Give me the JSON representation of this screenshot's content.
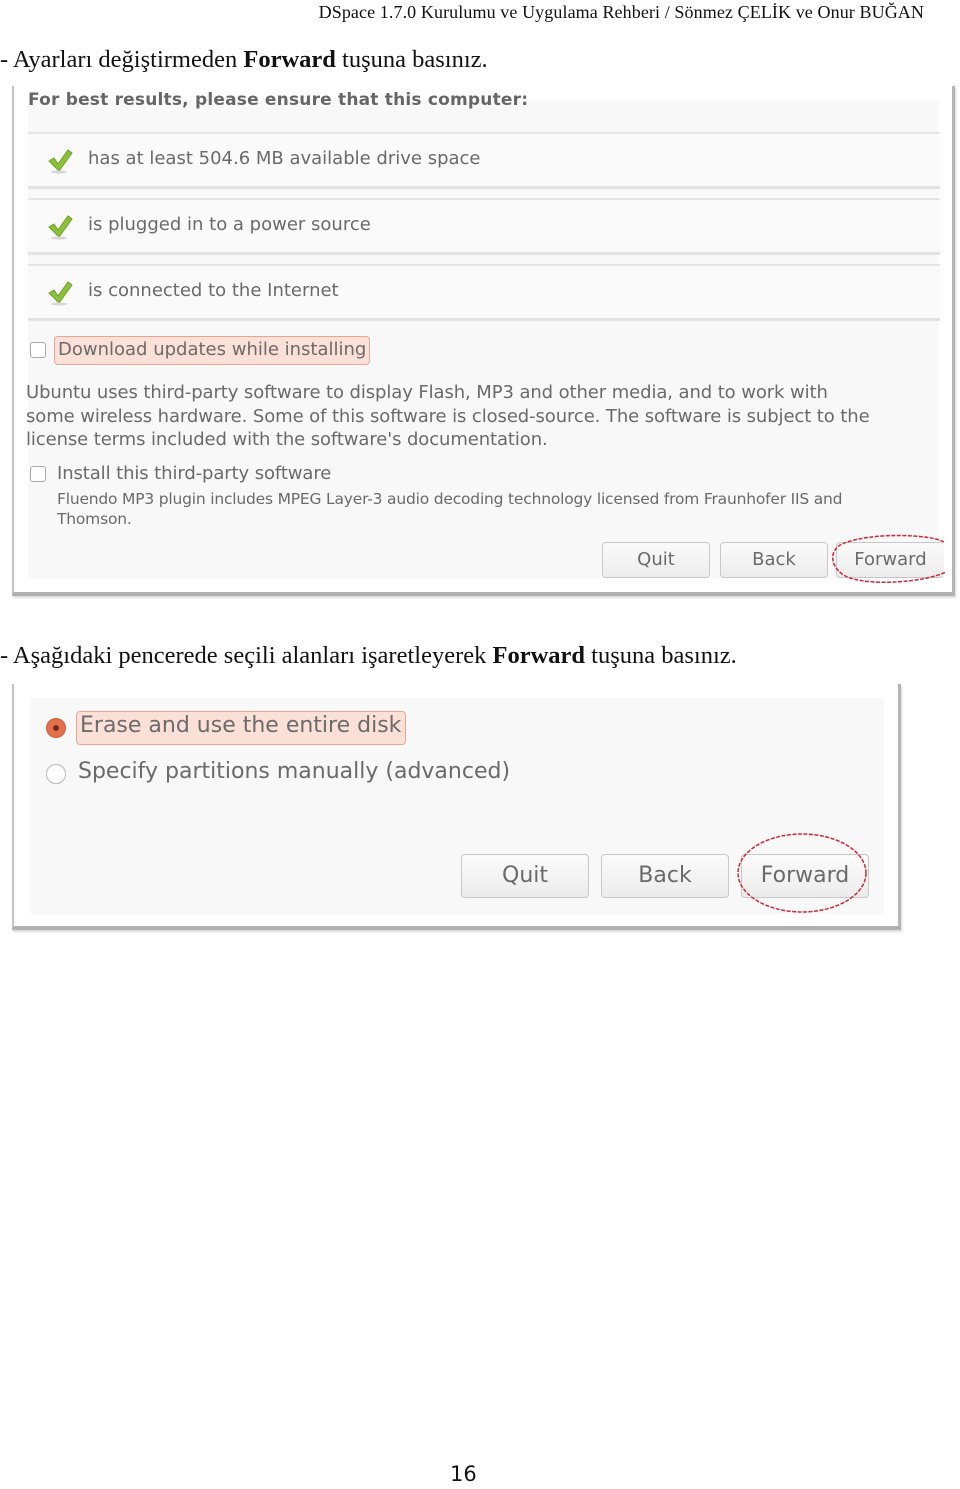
{
  "header": {
    "text": "DSpace 1.7.0  Kurulumu ve Uygulama Rehberi / Sönmez ÇELİK ve Onur BUĞAN"
  },
  "section1": {
    "instruction_prefix": "- Ayarları değiştirmeden ",
    "instruction_bold": "Forward",
    "instruction_suffix": " tuşuna basınız.",
    "screenshot": {
      "title": "For best results, please ensure that this computer:",
      "checks": [
        {
          "icon": "checkmark-icon",
          "label": "has at least 504.6 MB available drive space",
          "status": "ok"
        },
        {
          "icon": "checkmark-icon",
          "label": "is plugged in to a power source",
          "status": "ok"
        },
        {
          "icon": "checkmark-icon",
          "label": "is connected to the Internet",
          "status": "ok"
        }
      ],
      "download_updates": {
        "label": "Download updates while installing",
        "checked": false,
        "highlighted": true
      },
      "third_party_text": [
        "Ubuntu uses third-party software to display Flash, MP3 and other media, and to work with",
        "some wireless hardware. Some of this software is closed-source. The software is subject to the",
        "license terms included with the software's documentation."
      ],
      "install_third_party": {
        "label": "Install this third-party software",
        "checked": false
      },
      "fluendo_text": [
        "Fluendo MP3 plugin includes MPEG Layer-3 audio decoding technology licensed from Fraunhofer IIS and",
        "Thomson."
      ],
      "buttons": {
        "quit": "Quit",
        "back": "Back",
        "forward": "Forward"
      }
    }
  },
  "section2": {
    "instruction_prefix": "- Aşağıdaki pencerede seçili alanları işaretleyerek ",
    "instruction_bold": "Forward",
    "instruction_suffix": " tuşuna basınız.",
    "screenshot": {
      "options": [
        {
          "label": "Erase and use the entire disk",
          "selected": true,
          "highlighted": true
        },
        {
          "label": "Specify partitions manually (advanced)",
          "selected": false
        }
      ],
      "buttons": {
        "quit": "Quit",
        "back": "Back",
        "forward": "Forward"
      }
    }
  },
  "colors": {
    "highlight_fill": "#fbe0d8",
    "highlight_border": "#e8a58f",
    "annotation_circle": "#d0283a",
    "radio_selected": "#e4714e",
    "check_green": "#8cc13a"
  },
  "footer": {
    "page_number": "16"
  }
}
